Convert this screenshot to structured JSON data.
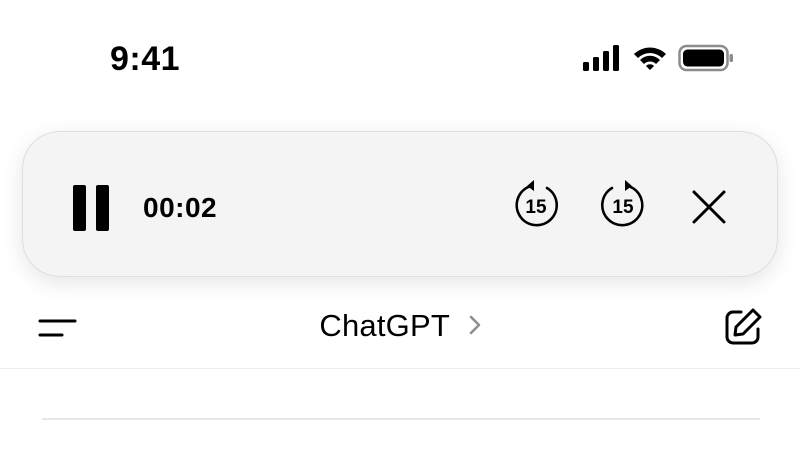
{
  "status_bar": {
    "time": "9:41",
    "icons": [
      "cellular-signal-icon",
      "wifi-icon",
      "battery-icon"
    ]
  },
  "player": {
    "elapsed": "00:02",
    "rewind_seconds": "15",
    "forward_seconds": "15",
    "icons": [
      "pause-icon",
      "rewind-15-icon",
      "forward-15-icon",
      "close-icon"
    ]
  },
  "nav": {
    "title": "ChatGPT",
    "icons": [
      "menu-icon",
      "chevron-right-icon",
      "new-chat-icon"
    ]
  },
  "colors": {
    "background": "#ffffff",
    "player_background": "#f4f4f4",
    "foreground": "#000000",
    "chevron": "#8e8e93",
    "divider": "#e8e8e8"
  }
}
